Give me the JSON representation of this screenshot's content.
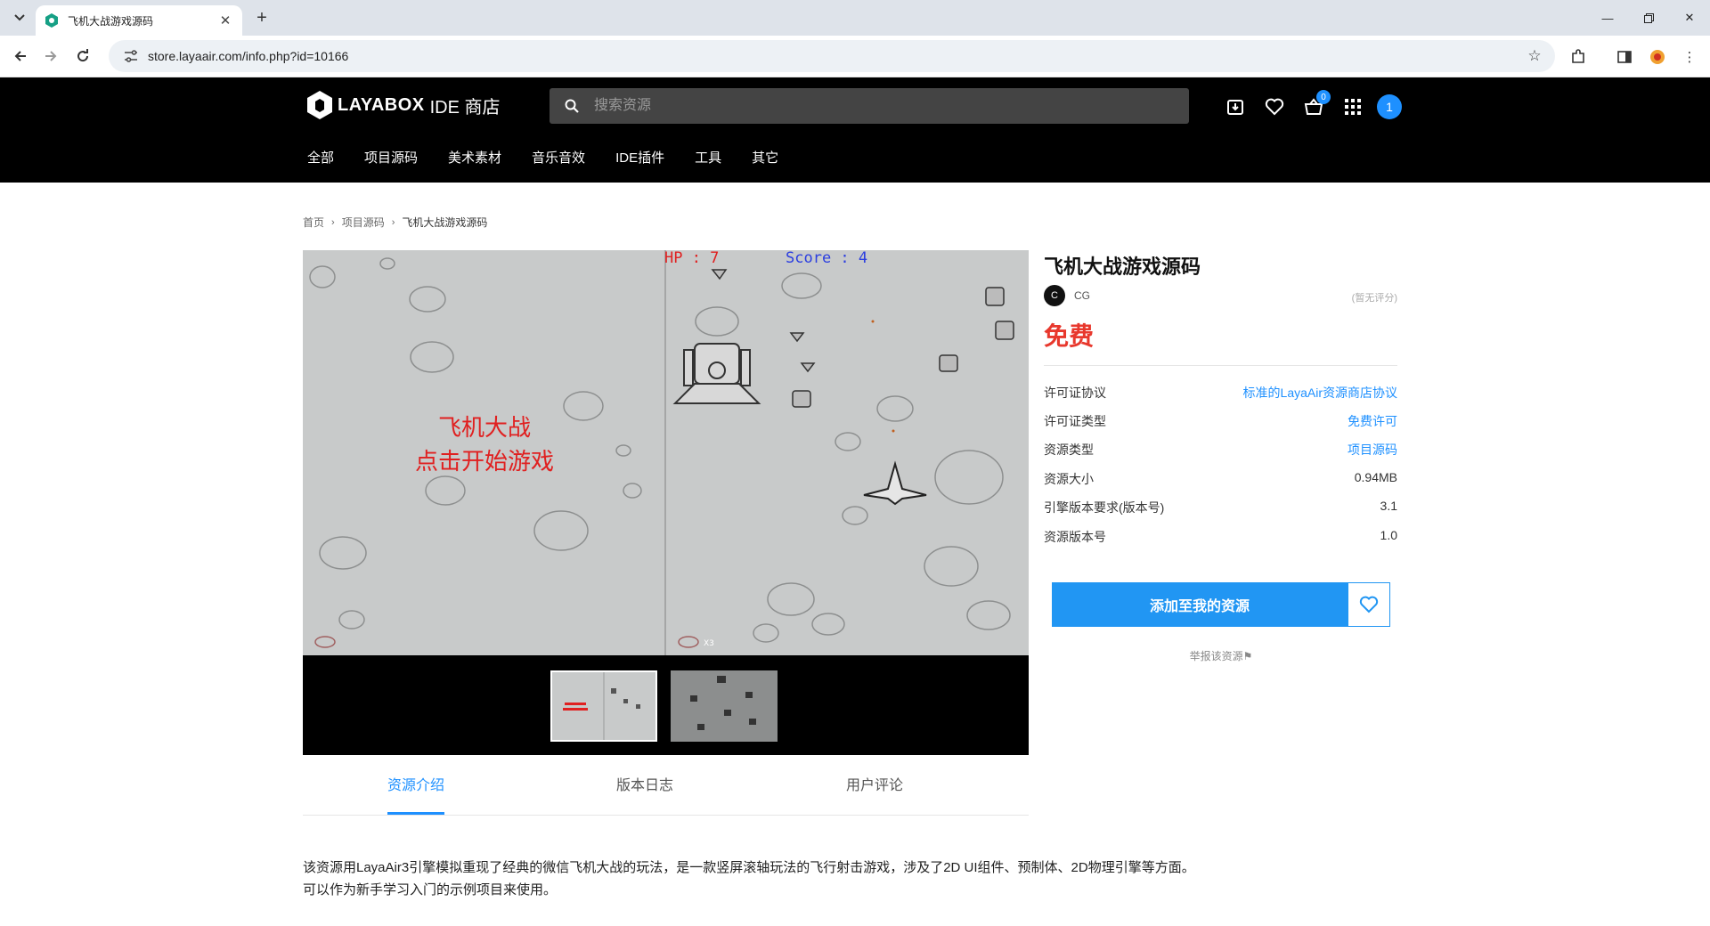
{
  "browser": {
    "tab_title": "飞机大战游戏源码",
    "url": "store.layaair.com/info.php?id=10166"
  },
  "site": {
    "logo_brand": "LAYABOX",
    "logo_sub": "IDE 商店",
    "search_placeholder": "搜索资源",
    "cart_count": "0",
    "user_avatar": "1",
    "nav": [
      "全部",
      "项目源码",
      "美术素材",
      "音乐音效",
      "IDE插件",
      "工具",
      "其它"
    ]
  },
  "breadcrumb": [
    "首页",
    "项目源码",
    "飞机大战游戏源码"
  ],
  "screenshot": {
    "hp_text": "HP : 7",
    "score_text": "Score : 4",
    "title_line1": "飞机大战",
    "title_line2": "点击开始游戏",
    "lives_text": "X3",
    "thumb_count": 2
  },
  "product": {
    "title": "飞机大战游戏源码",
    "author_initial": "C",
    "author_name": "CG",
    "rating": "(暂无评分)",
    "price": "免费",
    "attributes": [
      {
        "key": "许可证协议",
        "value": "标准的LayaAir资源商店协议",
        "link": true
      },
      {
        "key": "许可证类型",
        "value": "免费许可",
        "link": true
      },
      {
        "key": "资源类型",
        "value": "项目源码",
        "link": true
      },
      {
        "key": "资源大小",
        "value": "0.94MB",
        "link": false
      },
      {
        "key": "引擎版本要求(版本号)",
        "value": "3.1",
        "link": false
      },
      {
        "key": "资源版本号",
        "value": "1.0",
        "link": false
      }
    ],
    "add_button": "添加至我的资源",
    "report": "举报该资源"
  },
  "tabs": [
    "资源介绍",
    "版本日志",
    "用户评论"
  ],
  "description": {
    "line1": "该资源用LayaAir3引擎模拟重现了经典的微信飞机大战的玩法，是一款竖屏滚轴玩法的飞行射击游戏，涉及了2D UI组件、预制体、2D物理引擎等方面。",
    "line2": "可以作为新手学习入门的示例项目来使用。"
  },
  "colors": {
    "accent": "#1e90ff",
    "price": "#e8382d",
    "header_bg": "#000000",
    "button": "#2196f3"
  }
}
